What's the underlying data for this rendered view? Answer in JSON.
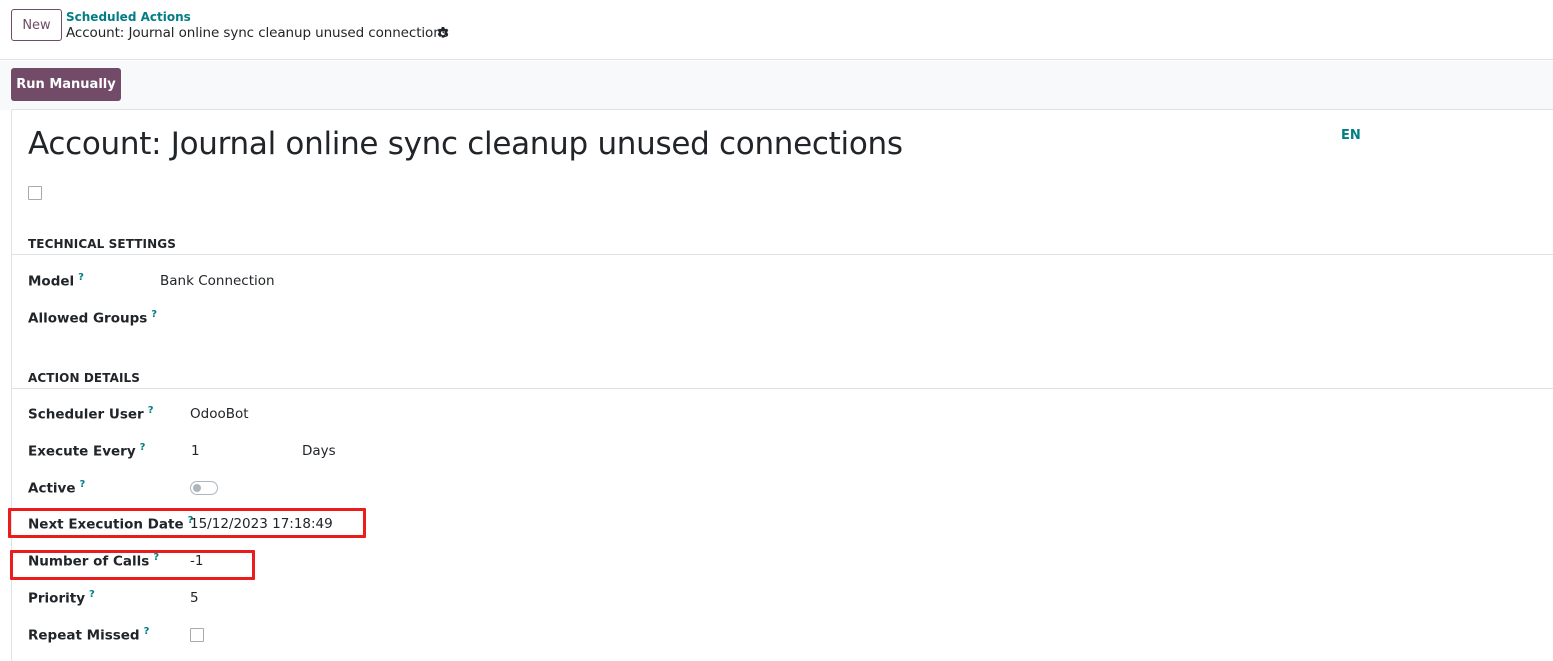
{
  "header": {
    "new_button": "New",
    "breadcrumb_parent": "Scheduled Actions",
    "breadcrumb_current": "Account: Journal online sync cleanup unused connections",
    "settings_icon": "gear-icon"
  },
  "control": {
    "run_manually": "Run Manually"
  },
  "record": {
    "title": "Account: Journal online sync cleanup unused connections",
    "language": "EN"
  },
  "technical_settings": {
    "heading": "TECHNICAL SETTINGS",
    "model_label": "Model",
    "model_value": "Bank Connection",
    "groups_label": "Allowed Groups",
    "help_mark": "?"
  },
  "action_details": {
    "heading": "ACTION DETAILS",
    "user_label": "Scheduler User",
    "user_value": "OdooBot",
    "every_label": "Execute Every",
    "every_number": "1",
    "every_unit": "Days",
    "active_label": "Active",
    "active_value": false,
    "next_label": "Next Execution Date",
    "next_value": "15/12/2023 17:18:49",
    "calls_label": "Number of Calls",
    "calls_value": "-1",
    "priority_label": "Priority",
    "priority_value": "5",
    "repeat_label": "Repeat Missed",
    "repeat_value": false
  },
  "colors": {
    "brand": "#714b67",
    "link": "#017e84",
    "highlight": "#ea1c1c"
  }
}
